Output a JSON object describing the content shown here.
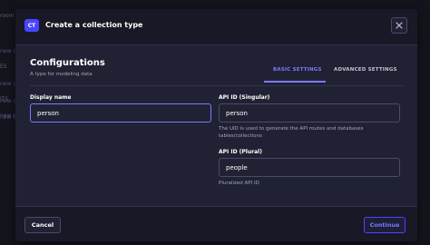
{
  "background": {
    "fragments": [
      {
        "text": "room",
        "muted": true
      },
      {
        "text": "new c",
        "muted": false
      },
      {
        "text": "ES",
        "muted": true
      },
      {
        "text": "new c",
        "muted": false
      },
      {
        "text": "new c",
        "muted": false
      },
      {
        "text": "ITS",
        "muted": true
      },
      {
        "text": "new c",
        "muted": false
      },
      {
        "text": "new c",
        "muted": false
      }
    ]
  },
  "modal": {
    "badge": "CT",
    "title": "Create a collection type",
    "close_icon": "close-icon"
  },
  "config": {
    "title": "Configurations",
    "subtitle": "A type for modeling data"
  },
  "tabs": [
    {
      "label": "BASIC SETTINGS",
      "active": true
    },
    {
      "label": "ADVANCED SETTINGS",
      "active": false
    }
  ],
  "form": {
    "display_name": {
      "label": "Display name",
      "value": "person"
    },
    "api_id_singular": {
      "label": "API ID (Singular)",
      "value": "person",
      "hint": "The UID is used to generate the API routes and databases tables/collections"
    },
    "api_id_plural": {
      "label": "API ID (Plural)",
      "value": "people",
      "hint": "Pluralized API ID"
    }
  },
  "footer": {
    "cancel_label": "Cancel",
    "continue_label": "Continue"
  },
  "colors": {
    "accent": "#7b79ff",
    "primary": "#4945ff",
    "surface": "#212134",
    "header": "#181826"
  }
}
